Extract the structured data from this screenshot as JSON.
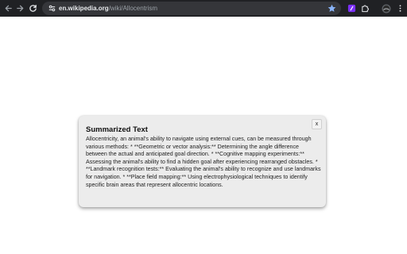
{
  "browser": {
    "url_host": "en.wikipedia.org",
    "url_path": "/wiki/Allocentrism",
    "icons": {
      "back": "back-arrow-icon",
      "forward": "forward-arrow-icon",
      "reload": "reload-icon",
      "site_info": "tune-icon",
      "bookmark": "star-icon",
      "extension": "extension-icon",
      "extensions_menu": "puzzle-icon",
      "profile": "avatar-icon",
      "menu": "kebab-menu-icon"
    },
    "colors": {
      "toolbar": "#202124",
      "omnibox": "#35363a",
      "star": "#8ab4f8",
      "extension": "#7b2ff7"
    }
  },
  "popup": {
    "title": "Summarized Text",
    "close_label": "x",
    "body": "Allocentricity, an animal's ability to navigate using external cues, can be measured through various methods: * **Geometric or vector analysis:** Determining the angle difference between the actual and anticipated goal direction. * **Cognitive mapping experiments:** Assessing the animal's ability to find a hidden goal after experiencing rearranged obstacles. * **Landmark recognition tests:** Evaluating the animal's ability to recognize and use landmarks for navigation. * **Place field mapping:** Using electrophysiological techniques to identify specific brain areas that represent allocentric locations."
  }
}
